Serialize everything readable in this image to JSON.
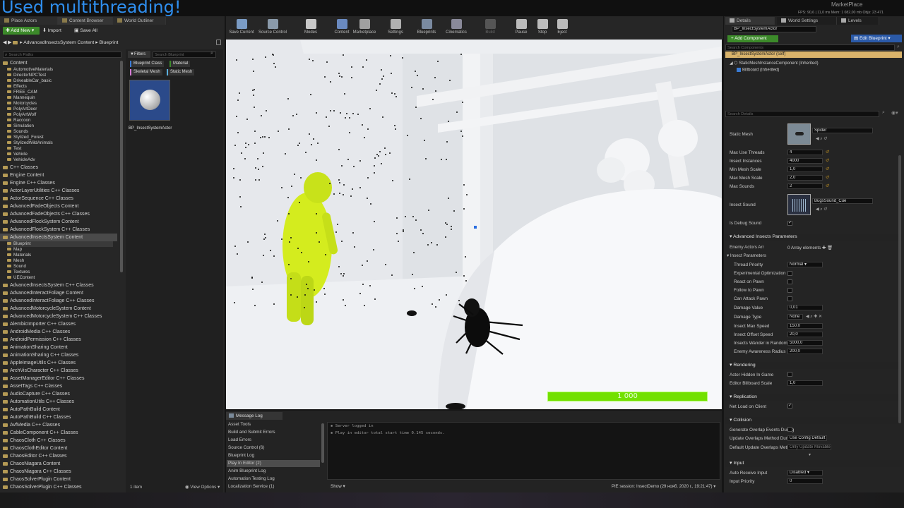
{
  "overlay_title": "Used multithreading!",
  "top_right": {
    "brand": "MarketPlace",
    "stats": "FPS: 90,6  |  11,0 ms  Mem: 1 082,00 mb  Objs: 23 471"
  },
  "left_tabs": [
    "Place Actors",
    "Content Browser",
    "World Outliner"
  ],
  "cb_toolbar": {
    "add_new": "Add New",
    "import": "Import",
    "save_all": "Save All"
  },
  "breadcrumb": {
    "root": "AdvancedInsectsSystem Content",
    "child": "Blueprint"
  },
  "search_paths_placeholder": "Search Paths",
  "filters_label": "Filters",
  "search_bp_placeholder": "Search Blueprint",
  "filter_chips": [
    "Blueprint Class",
    "Material",
    "Skeletal Mesh",
    "Static Mesh"
  ],
  "asset": {
    "name": "BP_InsectSystemActor"
  },
  "items_count": "1 item",
  "view_options": "View Options",
  "tree_content_root": "Content",
  "tree_content_children": [
    "AutomotiveMaterials",
    "DirectorNPCTest",
    "DriveableCar_basic",
    "Effects",
    "FREE_CAM",
    "Mannequin",
    "Motorcycles",
    "PolyArtDeer",
    "PolyArtWolf",
    "Raccoon",
    "Simulation",
    "Sounds",
    "Stylized_Forest",
    "StylizedWildAnimals",
    "Test",
    "Vehicle",
    "VehicleAdv"
  ],
  "tree_mid": [
    "C++ Classes",
    "Engine Content",
    "Engine C++ Classes",
    "ActorLayerUtilities C++ Classes",
    "ActorSequence C++ Classes",
    "AdvancedFadeObjects Content",
    "AdvancedFadeObjects C++ Classes",
    "AdvancedFlockSystem Content",
    "AdvancedFlockSystem C++ Classes",
    "AdvancedInsectsSystem Content"
  ],
  "tree_ais_children": [
    "Blueprint",
    "Map",
    "Materials",
    "Mesh",
    "Sound",
    "Textures",
    "UEContent"
  ],
  "tree_rest": [
    "AdvancedInsectsSystem C++ Classes",
    "AdvancedInteractFoliage Content",
    "AdvancedInteractFoliage C++ Classes",
    "AdvancedMotorcycleSystem Content",
    "AdvancedMotorcycleSystem C++ Classes",
    "AlembicImporter C++ Classes",
    "AndroidMedia C++ Classes",
    "AndroidPermission C++ Classes",
    "AnimationSharing Content",
    "AnimationSharing C++ Classes",
    "AppleImageUtils C++ Classes",
    "ArchVisCharacter C++ Classes",
    "AssetManagerEditor C++ Classes",
    "AssetTags C++ Classes",
    "AudioCapture C++ Classes",
    "AutomationUtils C++ Classes",
    "AutoPathBuild Content",
    "AutoPathBuild C++ Classes",
    "AvfMedia C++ Classes",
    "CableComponent C++ Classes",
    "ChaosCloth C++ Classes",
    "ChaosClothEditor Content",
    "ChaosEditor C++ Classes",
    "ChaosNiagara Content",
    "ChaosNiagara C++ Classes",
    "ChaosSolverPlugin Content",
    "ChaosSolverPlugin C++ Classes"
  ],
  "main_toolbar": [
    "Save Current",
    "Source Control",
    "Modes",
    "Content",
    "Marketplace",
    "Settings",
    "Blueprints",
    "Cinematics",
    "Build",
    "Pause",
    "Stop",
    "Eject"
  ],
  "hud_value": "1 000",
  "message_log": {
    "tab": "Message Log",
    "categories": [
      "Asset Tools",
      "Build and Submit Errors",
      "Load Errors",
      "Source Control (6)",
      "Blueprint Log",
      "Play In Editor (2)",
      "Anim Blueprint Log",
      "Automation Testing Log",
      "Localization Service (1)"
    ],
    "lines": [
      "Server logged in",
      "Play in editor total start time 0.145 seconds."
    ],
    "show": "Show",
    "session": "PIE session: InsectDemo (29 нояб. 2020 г., 19:21:47)"
  },
  "right_tabs": [
    "Details",
    "World Settings",
    "Levels"
  ],
  "details": {
    "name_field": "BP_InsectSystemActor",
    "add_component": "+ Add Component",
    "edit_blueprint": "Edit Blueprint",
    "search_components_placeholder": "Search Components",
    "components": [
      "BP_InsectSystemActor (self)",
      "StaticMeshInstanceComponent (Inherited)",
      "Billboard (Inherited)"
    ],
    "search_details_placeholder": "Search Details",
    "static_mesh_label": "Static Mesh",
    "static_mesh_value": "Spider",
    "props1": [
      {
        "label": "Max Use Threads",
        "value": "4"
      },
      {
        "label": "Insect Instances",
        "value": "4000"
      },
      {
        "label": "Min Mesh Scale",
        "value": "1,0"
      },
      {
        "label": "Max Mesh Scale",
        "value": "2,0"
      },
      {
        "label": "Max Sounds",
        "value": "2"
      }
    ],
    "insect_sound_label": "Insect Sound",
    "insect_sound_value": "BugsSound_Cue",
    "is_debug_sound": "Is Debug Sound",
    "section_params": "Advanced Insects Parameters",
    "enemy_actors_label": "Enemy Actors Arr",
    "enemy_actors_value": "0 Array elements",
    "insect_params": "Insect Parameters",
    "thread_priority_label": "Thread Priority",
    "thread_priority_value": "Normal",
    "checks": [
      "Experimental Optimization",
      "React on Pawn",
      "Follow to Pawn",
      "Can Attack Pawn"
    ],
    "damage_value_label": "Damage Value",
    "damage_value": "0,01",
    "damage_type_label": "Damage Type",
    "damage_type_value": "None",
    "props2": [
      {
        "label": "Insect Max Speed",
        "value": "150,0"
      },
      {
        "label": "Insect Offset Speed",
        "value": "20,0"
      },
      {
        "label": "Insects Wander in Random R",
        "value": "5000,0"
      },
      {
        "label": "Enemy Awareness Radius",
        "value": "200,0"
      }
    ],
    "section_rendering": "Rendering",
    "actor_hidden": "Actor Hidden In Game",
    "billboard_scale_label": "Editor Billboard Scale",
    "billboard_scale": "1,0",
    "section_replication": "Replication",
    "net_load": "Net Load on Client",
    "section_collision": "Collision",
    "gen_overlap": "Generate Overlap Events During",
    "update_overlaps_label": "Update Overlaps Method During",
    "update_overlaps_value": "Use Config Default",
    "default_update_label": "Default Update Overlaps Metho",
    "default_update_value": "Only Update Movable",
    "section_input": "Input",
    "auto_receive_label": "Auto Receive Input",
    "auto_receive_value": "Disabled",
    "input_priority_label": "Input Priority",
    "input_priority_value": "0"
  }
}
